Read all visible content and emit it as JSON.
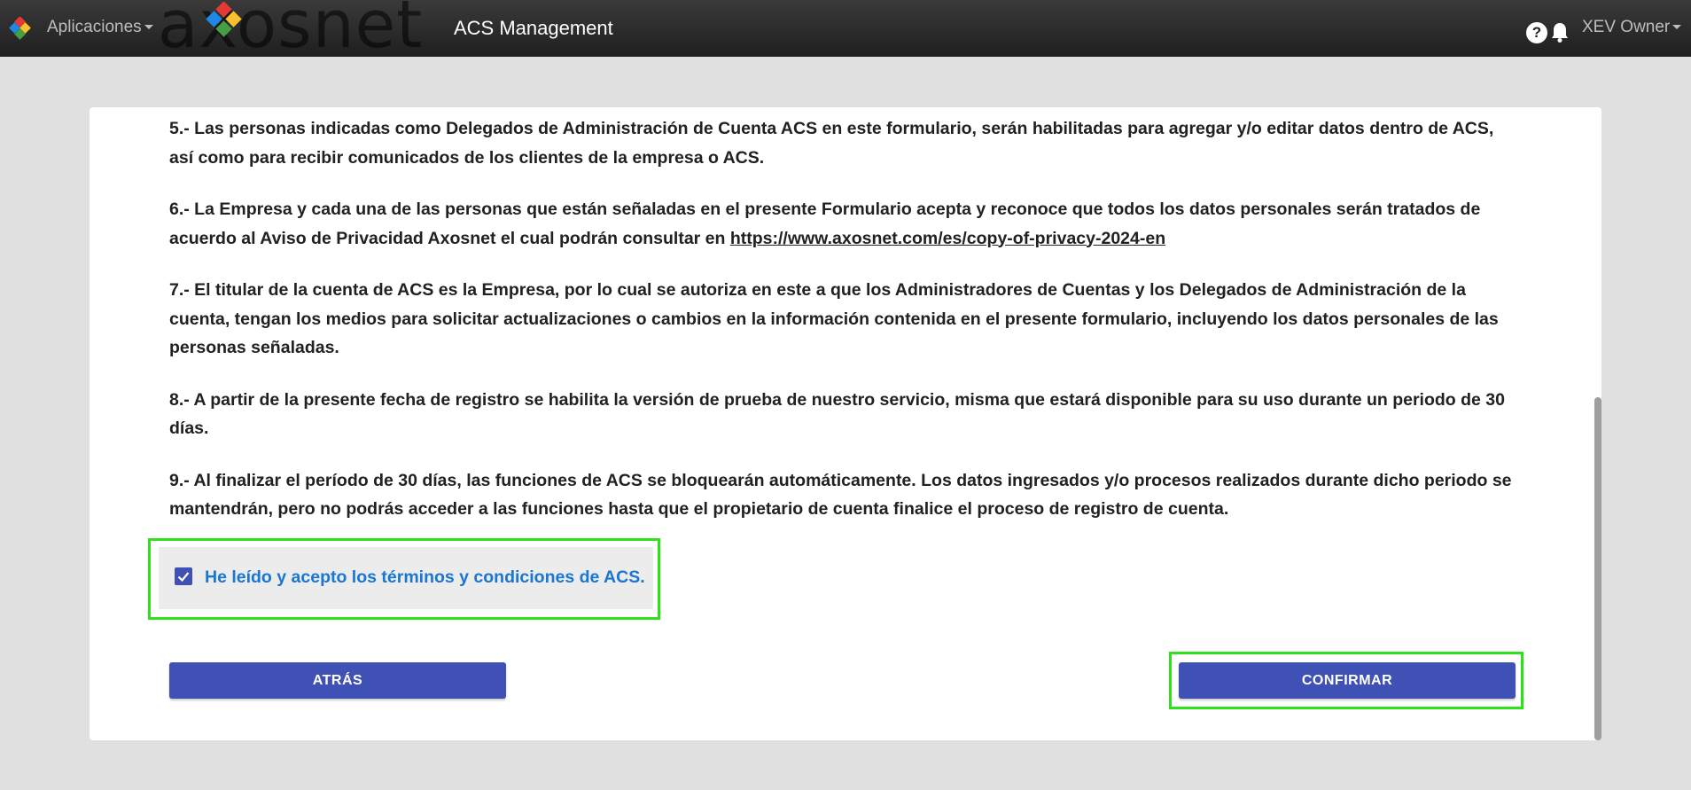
{
  "header": {
    "apps_label": "Aplicaciones",
    "brand_text": "axosnet",
    "title": "ACS Management",
    "help_symbol": "?",
    "user_label": "XEV Owner"
  },
  "terms": [
    "5.- Las personas indicadas como Delegados de Administración de Cuenta ACS en este formulario, serán habilitadas para agregar y/o editar datos dentro de ACS, así como para recibir comunicados de los clientes de la empresa o ACS.",
    "6.- La Empresa y cada una de las personas que están señaladas en el presente Formulario acepta y reconoce que todos los datos personales serán tratados de acuerdo al Aviso de Privacidad Axosnet el cual podrán consultar en ",
    "7.- El titular de la cuenta de ACS es la Empresa, por lo cual se autoriza en este a que los Administradores de Cuentas y los Delegados de Administración de la cuenta, tengan los medios para solicitar actualizaciones o cambios en la información contenida en el presente formulario, incluyendo los datos personales de las personas señaladas.",
    "8.- A partir de la presente fecha de registro se habilita la versión de prueba de nuestro servicio, misma que estará disponible para su uso durante un periodo de 30 días.",
    "9.- Al finalizar el período de 30 días, las funciones de ACS se bloquearán automáticamente. Los datos ingresados y/o procesos realizados durante dicho periodo se mantendrán, pero no podrás acceder a las funciones hasta que el propietario de cuenta finalice el proceso de registro de cuenta."
  ],
  "privacy_link": "https://www.axosnet.com/es/copy-of-privacy-2024-en",
  "acceptance": {
    "checked": true,
    "label": "He leído y acepto los términos y condiciones de ACS."
  },
  "buttons": {
    "back": "ATRÁS",
    "confirm": "CONFIRMAR"
  },
  "colors": {
    "primary": "#3f51b5",
    "link_blue": "#1976d2",
    "highlight_outline": "#2ee21a",
    "topbar": "#2b2b2b"
  },
  "icons": {
    "apps": "apps-logo-icon",
    "help": "help-icon",
    "notifications": "bell-icon",
    "checkbox": "checkbox-checked-icon"
  }
}
